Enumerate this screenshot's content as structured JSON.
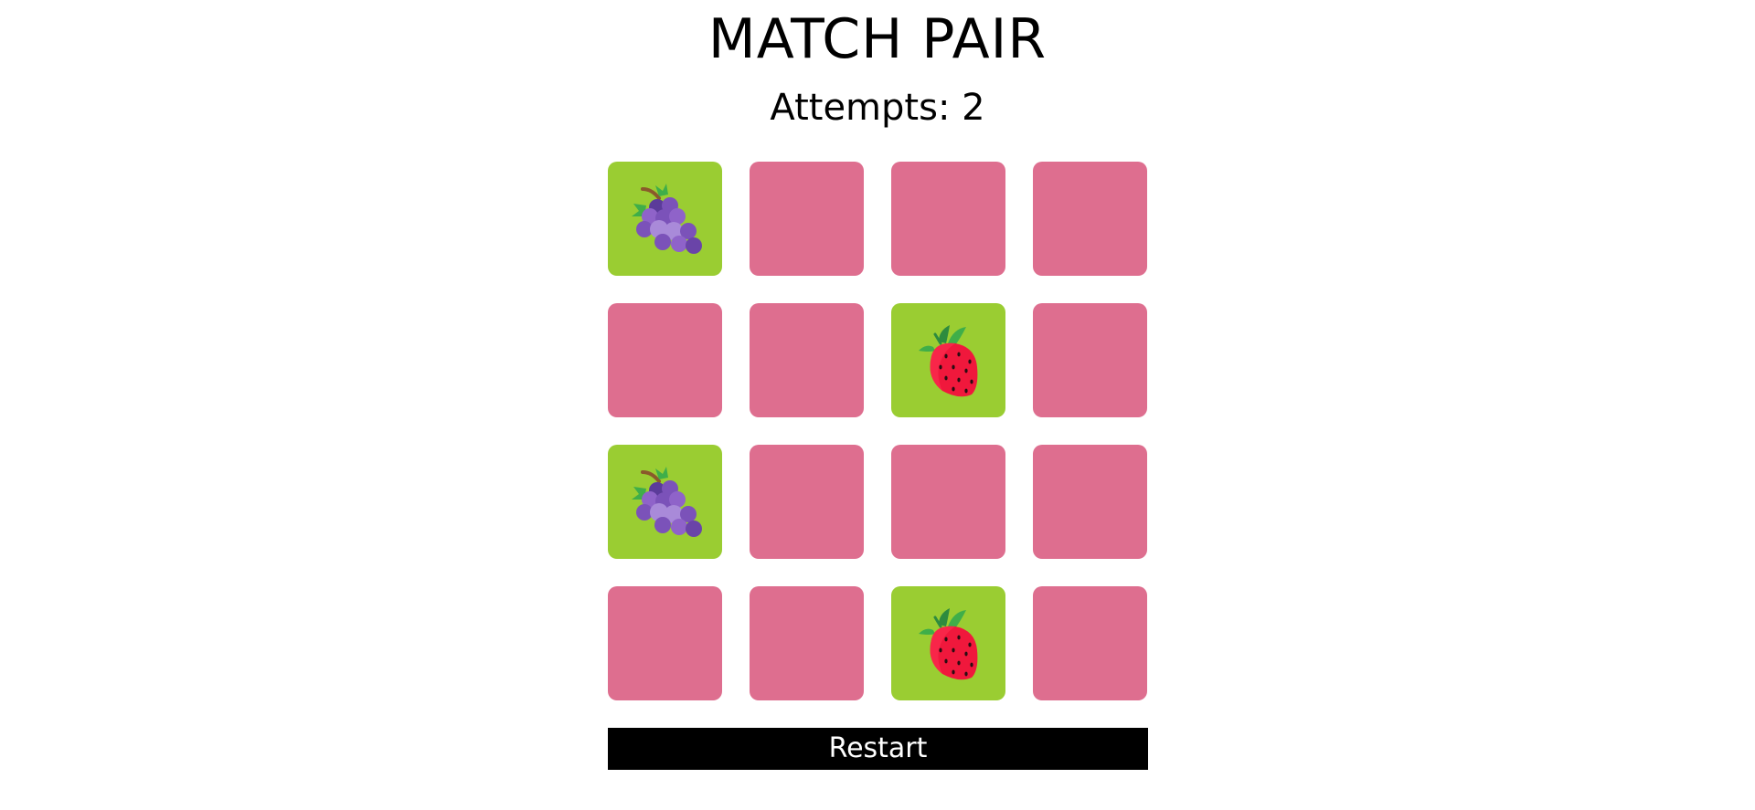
{
  "title": "MATCH PAIR",
  "attempts": "Attempts: 2",
  "restart_label": "Restart",
  "colors": {
    "card_back": "#de6e8f",
    "card_revealed": "#9acd32",
    "button_bg": "#000000",
    "button_text": "#ffffff"
  },
  "cards": [
    {
      "state": "revealed",
      "fruit": "grapes-icon"
    },
    {
      "state": "hidden"
    },
    {
      "state": "hidden"
    },
    {
      "state": "hidden"
    },
    {
      "state": "hidden"
    },
    {
      "state": "hidden"
    },
    {
      "state": "revealed",
      "fruit": "strawberry-icon"
    },
    {
      "state": "hidden"
    },
    {
      "state": "revealed",
      "fruit": "grapes-icon"
    },
    {
      "state": "hidden"
    },
    {
      "state": "hidden"
    },
    {
      "state": "hidden"
    },
    {
      "state": "hidden"
    },
    {
      "state": "hidden"
    },
    {
      "state": "revealed",
      "fruit": "strawberry-icon"
    },
    {
      "state": "hidden"
    }
  ]
}
